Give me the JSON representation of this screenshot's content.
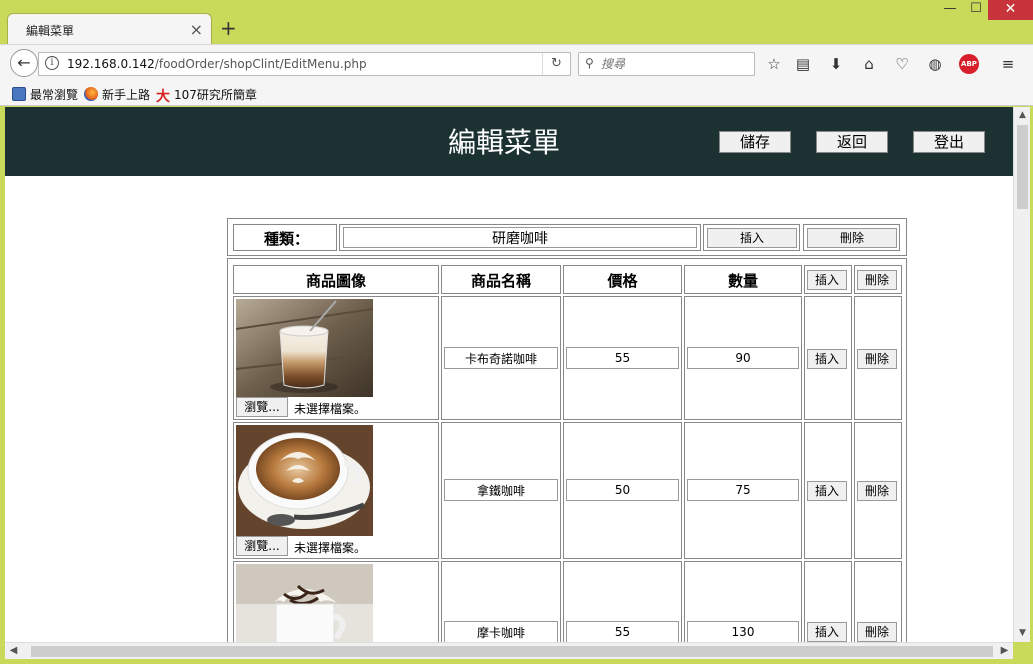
{
  "browser": {
    "tab_title": "編輯菜單",
    "url_host": "192.168.0.142",
    "url_path": "/foodOrder/shopClint/EditMenu.php",
    "search_placeholder": "搜尋",
    "bookmarks": [
      {
        "label": "最常瀏覽",
        "icon": "bookmark-folder-icon"
      },
      {
        "label": "新手上路",
        "icon": "firefox-icon"
      },
      {
        "label": "107研究所簡章",
        "icon": "site-da-icon"
      }
    ],
    "toolbar_icons": [
      "star-icon",
      "reading-list-icon",
      "download-icon",
      "home-icon",
      "pocket-icon",
      "globe-icon",
      "adblock-icon",
      "menu-icon"
    ],
    "abp_text": "ABP"
  },
  "header": {
    "title": "編輯菜單",
    "save_label": "儲存",
    "back_label": "返回",
    "logout_label": "登出",
    "bg_color": "#1c3232"
  },
  "category": {
    "label": "種類：",
    "value": "研磨咖啡",
    "insert_label": "插入",
    "delete_label": "刪除"
  },
  "table": {
    "headers": {
      "image": "商品圖像",
      "name": "商品名稱",
      "price": "價格",
      "qty": "數量",
      "insert": "插入",
      "delete": "刪除"
    },
    "browse_label": "瀏覽...",
    "no_file_label": "未選擇檔案。",
    "row_insert_label": "插入",
    "row_delete_label": "刪除",
    "rows": [
      {
        "name": "卡布奇諾咖啡",
        "price": "55",
        "qty": "90",
        "photo": "layered-coffee-glass"
      },
      {
        "name": "拿鐵咖啡",
        "price": "50",
        "qty": "75",
        "photo": "latte-art-cup"
      },
      {
        "name": "摩卡咖啡",
        "price": "55",
        "qty": "130",
        "photo": "mocha-whipped-cream"
      }
    ]
  }
}
